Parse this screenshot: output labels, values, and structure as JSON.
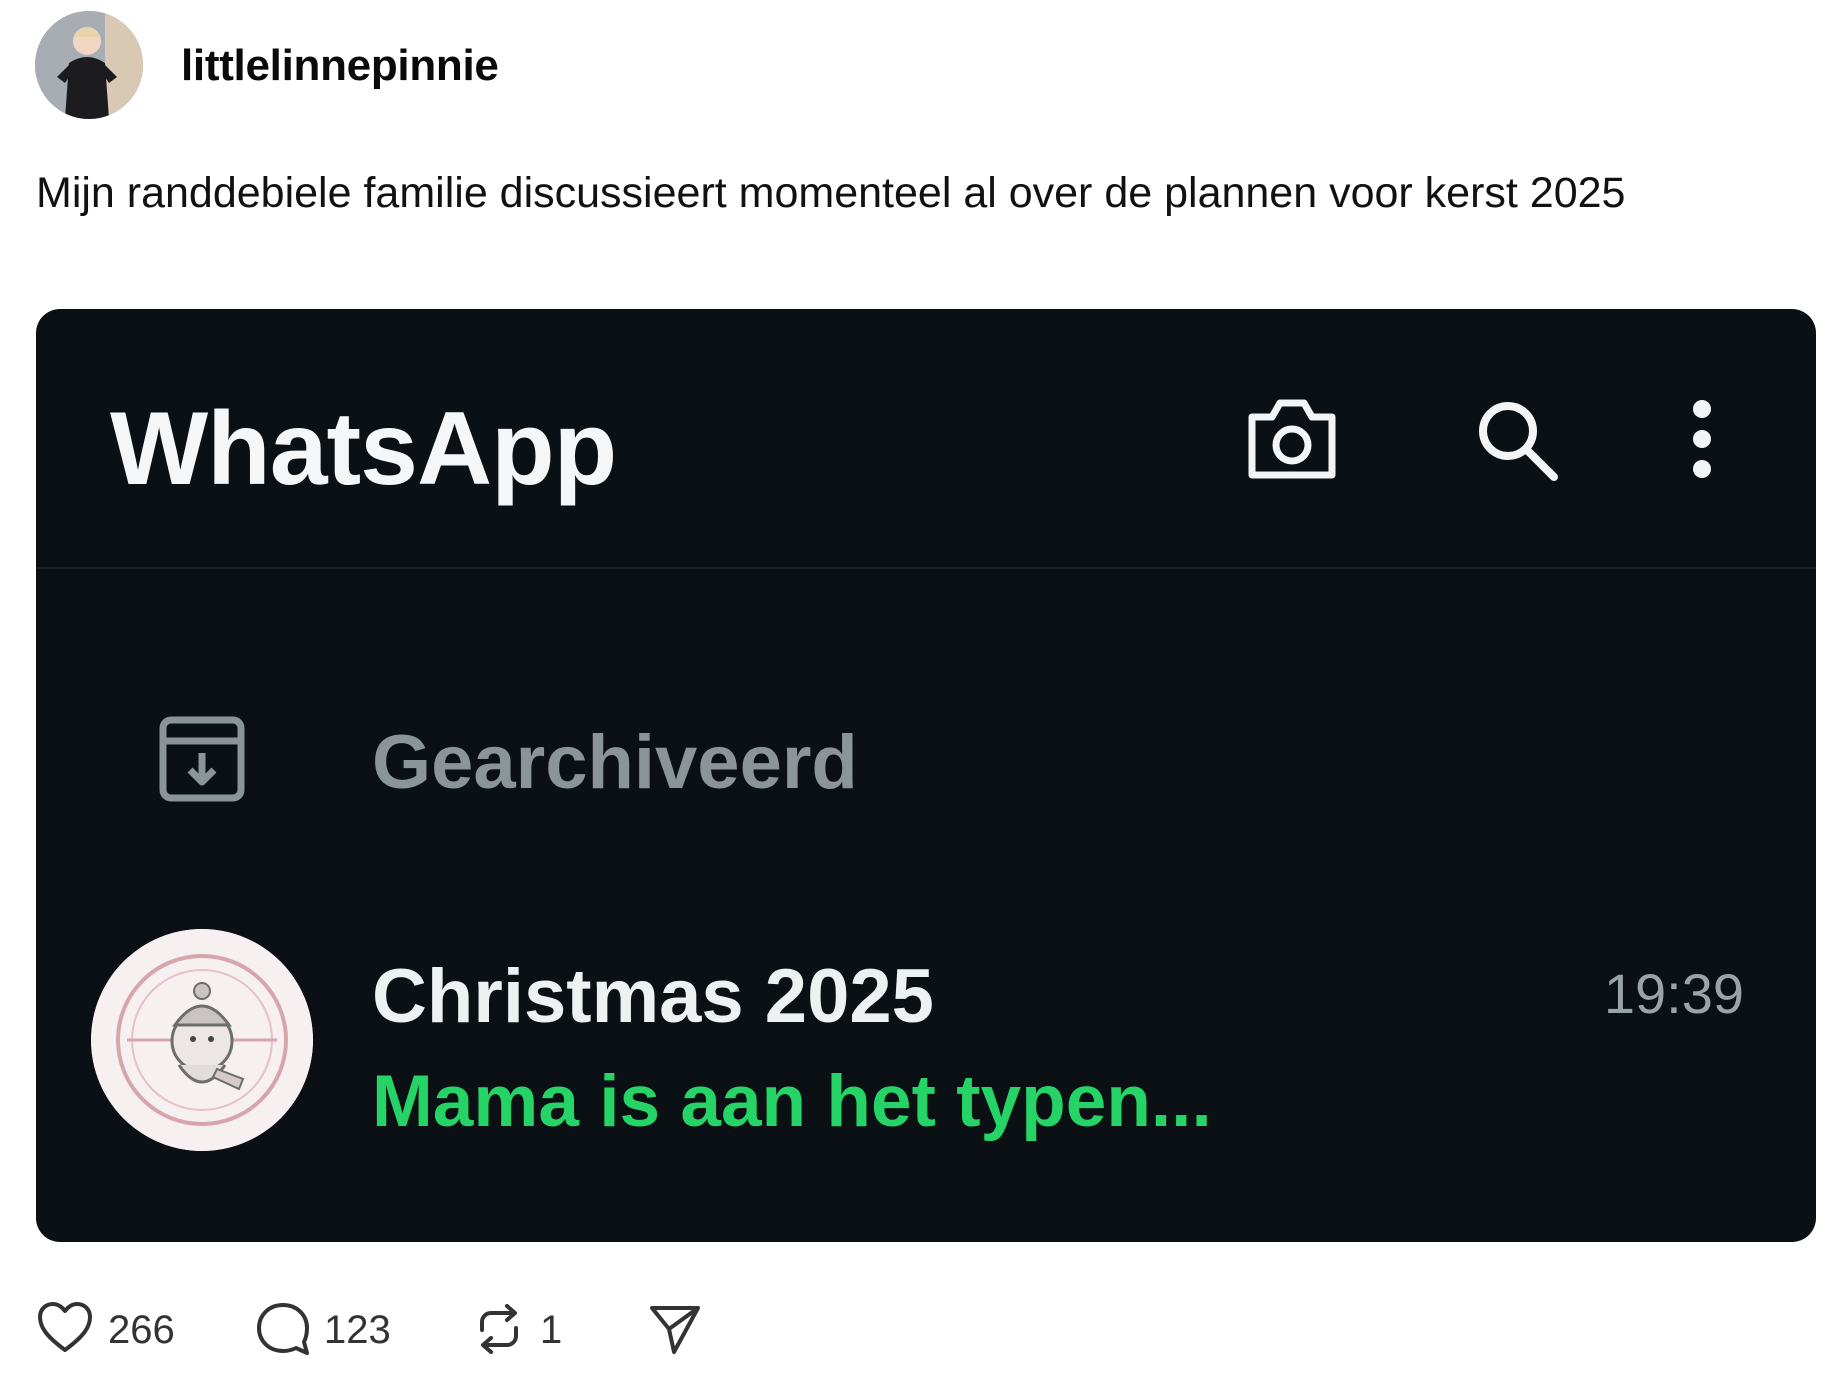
{
  "post": {
    "username": "littlelinnepinnie",
    "text": "Mijn randdebiele familie discussieert momenteel al over de plannen voor kerst 2025"
  },
  "media": {
    "app_title": "WhatsApp",
    "header_icons": [
      "camera-icon",
      "search-icon",
      "more-vertical-icon"
    ],
    "archived_label": "Gearchiveerd",
    "archived_icon": "archive-icon",
    "chat": {
      "name": "Christmas 2025",
      "time": "19:39",
      "preview": "Mama is aan het typen..."
    },
    "colors": {
      "background": "#0b1014",
      "typing_green": "#25d366",
      "muted_text": "#8a9499"
    }
  },
  "actions": {
    "likes": "266",
    "replies": "123",
    "reposts": "1",
    "icons": [
      "heart-icon",
      "comment-icon",
      "repost-icon",
      "send-icon"
    ]
  }
}
